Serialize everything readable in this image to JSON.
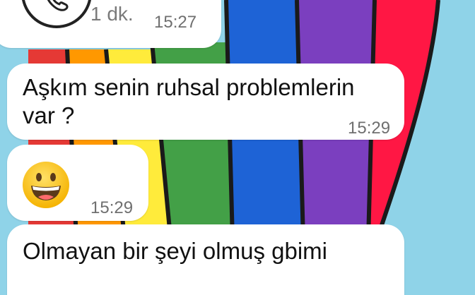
{
  "messages": [
    {
      "type": "call",
      "duration": "1 dk.",
      "time": "15:27",
      "icon": "phone-icon"
    },
    {
      "type": "text",
      "lines": [
        "Aşkım senin ruhsal problemlerin",
        "var ?"
      ],
      "time": "15:29"
    },
    {
      "type": "emoji",
      "emoji": "😀",
      "icon": "grinning-face-emoji",
      "time": "15:29"
    },
    {
      "type": "text",
      "lines": [
        "Olmayan bir şeyi olmuş gbimi"
      ]
    }
  ],
  "colors": {
    "sky": "#8fd3e8",
    "bubble": "#ffffff",
    "meta_text": "#6f6f6f",
    "stripes": [
      "#e53935",
      "#ff9800",
      "#ffeb3b",
      "#43a047",
      "#1e63d6",
      "#7b3fbf",
      "#ff1744"
    ]
  }
}
